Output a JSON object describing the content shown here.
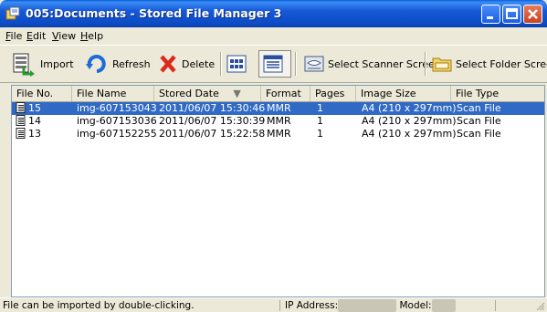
{
  "window": {
    "title": "005:Documents - Stored File Manager 3",
    "controls": [
      "minimize-icon",
      "maximize-icon",
      "close-icon"
    ]
  },
  "menu": [
    {
      "label": "File",
      "underline": "F"
    },
    {
      "label": "Edit",
      "underline": "E"
    },
    {
      "label": "View",
      "underline": "V"
    },
    {
      "label": "Help",
      "underline": "H"
    }
  ],
  "toolbar": {
    "import_label": "Import",
    "refresh_label": "Refresh",
    "delete_label": "Delete",
    "scanner_label": "Select Scanner Screen",
    "folder_label": "Select Folder Screen"
  },
  "table": {
    "columns": [
      "File No.",
      "File Name",
      "Stored Date",
      "Format",
      "Pages",
      "Image Size",
      "File Type"
    ],
    "sort_indicator": "▼",
    "rows": [
      {
        "no": "15",
        "name": "img-607153043",
        "date": "2011/06/07 15:30:46",
        "format": "MMR",
        "pages": "1",
        "size": "A4 (210 x 297mm)",
        "type": "Scan File",
        "selected": true
      },
      {
        "no": "14",
        "name": "img-607153036",
        "date": "2011/06/07 15:30:39",
        "format": "MMR",
        "pages": "1",
        "size": "A4 (210 x 297mm)",
        "type": "Scan File",
        "selected": false
      },
      {
        "no": "13",
        "name": "img-607152255",
        "date": "2011/06/07 15:22:58",
        "format": "MMR",
        "pages": "1",
        "size": "A4 (210 x 297mm)",
        "type": "Scan File",
        "selected": false
      }
    ]
  },
  "status": {
    "hint": "File can be imported by double-clicking.",
    "ip_label": "IP Address:",
    "model_label": "Model:"
  },
  "colors": {
    "selection": "#316ac5",
    "titlebar": "#0c4cc6"
  }
}
